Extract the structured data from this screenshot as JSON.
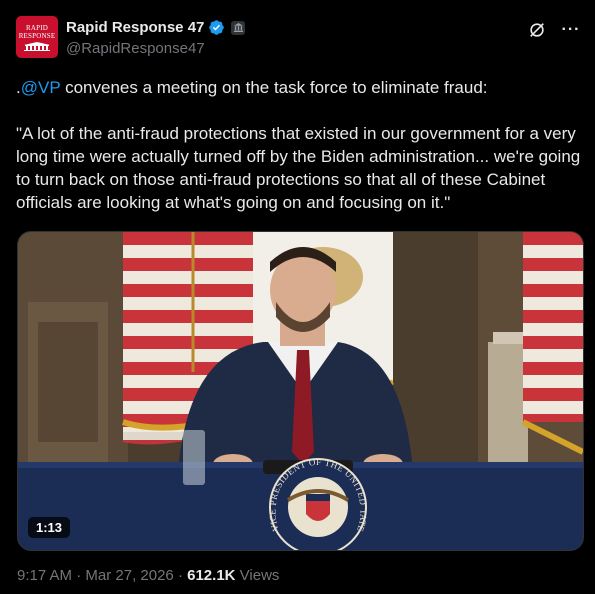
{
  "author": {
    "avatar_line1": "RAPID",
    "avatar_line2": "RESPONSE",
    "name": "Rapid Response 47",
    "handle": "@RapidResponse47",
    "verified_color": "#1d9bf0"
  },
  "icons": {
    "grok": "grok-icon",
    "more": "more-icon",
    "more_glyph": "···"
  },
  "tweet": {
    "prefix": ".",
    "mention": "@VP",
    "line1_rest": " convenes a meeting on the task force to eliminate fraud:",
    "quote": "\"A lot of the anti-fraud protections that existed in our government for a very long time were actually turned off by the Biden administration... we're going to turn back on those anti-fraud protections so that all of these Cabinet officials are looking at what's going on and focusing on it.\""
  },
  "video": {
    "duration": "1:13",
    "seal_text_top": "PRESIDENT OF THE UNITED",
    "seal_text_left": "VICE",
    "seal_text_right": "STATES"
  },
  "meta": {
    "time": "9:17 AM",
    "sep1": " · ",
    "date": "Mar 27, 2026",
    "sep2": " · ",
    "views_count": "612.1K",
    "views_label": " Views"
  },
  "colors": {
    "accent": "#1d9bf0",
    "avatar_bg": "#c8102e",
    "muted": "#71767b"
  }
}
